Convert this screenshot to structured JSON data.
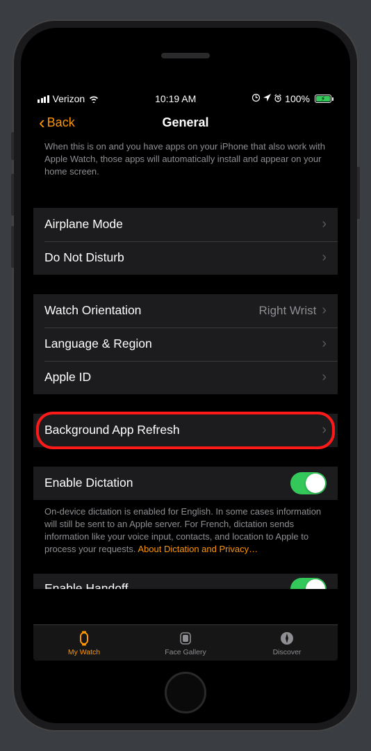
{
  "status": {
    "carrier": "Verizon",
    "time": "10:19 AM",
    "battery_pct": "100%"
  },
  "nav": {
    "back_label": "Back",
    "title": "General"
  },
  "header_description": "When this is on and you have apps on your iPhone that also work with Apple Watch, those apps will automatically install and appear on your home screen.",
  "group1": {
    "airplane": "Airplane Mode",
    "dnd": "Do Not Disturb"
  },
  "group2": {
    "orientation_label": "Watch Orientation",
    "orientation_value": "Right Wrist",
    "language": "Language & Region",
    "apple_id": "Apple ID"
  },
  "group3": {
    "bar": "Background App Refresh"
  },
  "group4": {
    "dictation": "Enable Dictation",
    "dictation_footer": "On-device dictation is enabled for English. In some cases information will still be sent to an Apple server. For French, dictation sends information like your voice input, contacts, and location to Apple to process your requests. ",
    "dictation_link": "About Dictation and Privacy…"
  },
  "group5": {
    "handoff": "Enable Handoff"
  },
  "tabs": {
    "my_watch": "My Watch",
    "face_gallery": "Face Gallery",
    "discover": "Discover"
  }
}
